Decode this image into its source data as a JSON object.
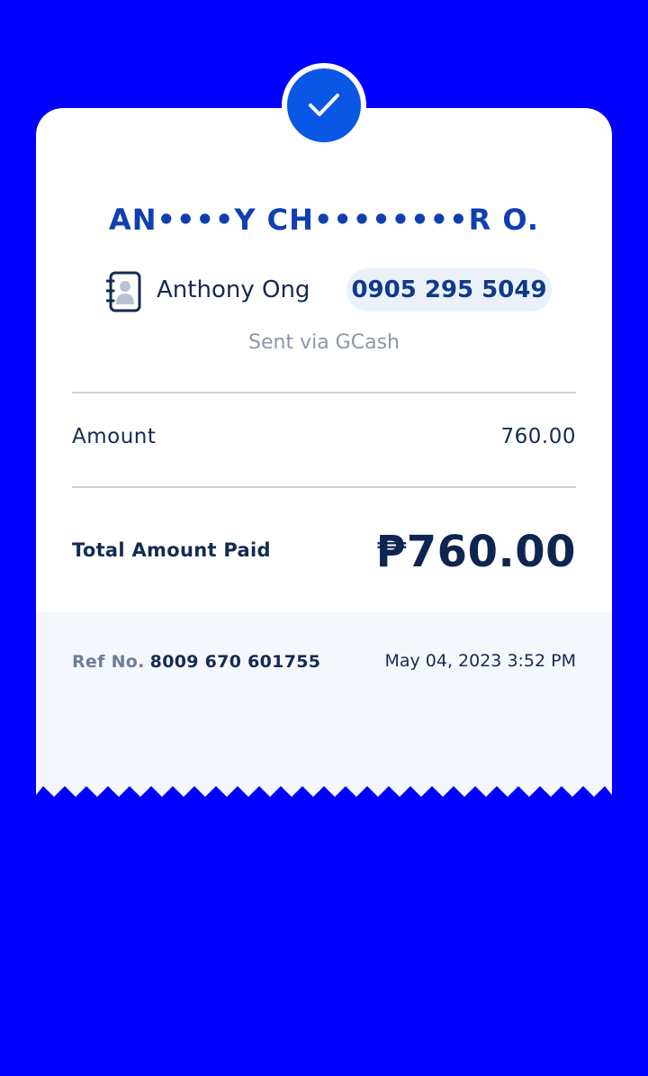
{
  "recipient": {
    "masked_name": "AN••••Y CH••••••••R O.",
    "contact_name": "Anthony Ong",
    "phone": "0905 295 5049",
    "sent_via": "Sent via GCash"
  },
  "amount": {
    "label": "Amount",
    "value": "760.00"
  },
  "total": {
    "label": "Total Amount Paid",
    "value": "₱760.00"
  },
  "reference": {
    "label": "Ref No.",
    "number": "8009 670 601755",
    "datetime": "May 04, 2023 3:52 PM"
  },
  "colors": {
    "background": "#0000FF",
    "accent": "#0A57E6",
    "name_blue": "#0F3FB2",
    "receipt_footer": "#F4F7FC",
    "text_dark": "#142B52"
  },
  "icons": {
    "status": "check-icon",
    "contact": "contact-book-icon"
  }
}
